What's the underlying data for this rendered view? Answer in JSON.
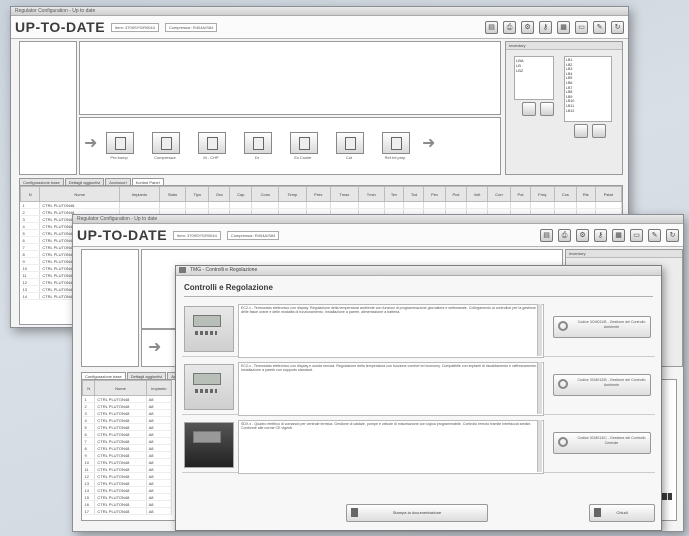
{
  "brand": {
    "logo_text": "UP-TO-DATE"
  },
  "back_window": {
    "titlebar_text": "Regulator Configuration - Up to date",
    "app_fields": [
      "Item: 3709SYS/R0044",
      "Compressor: R404A/S84"
    ],
    "tool_icons": [
      "document-icon",
      "printer-icon",
      "network-icon",
      "key-icon",
      "table-icon",
      "monitor-icon",
      "edit-icon",
      "refresh-icon"
    ],
    "flow_steps": [
      "Pre.bump",
      "Compressor",
      "M - CHP",
      "Dr",
      "Ev.Cooler",
      "Cut",
      "Ref.Inf.pmp"
    ],
    "side_panel": {
      "header": "Inventory",
      "left_list": [
        "LBA",
        "LB",
        "LB2"
      ],
      "right_list": [
        "LB1",
        "LB2",
        "LB3",
        "LB4",
        "LB5",
        "LB6",
        "LB7",
        "LB8",
        "LB9",
        "LB10",
        "LB11",
        "LB12"
      ]
    },
    "tabs": [
      "Configurazione base",
      "Dettagli aggiuntivi",
      "Accessori",
      "Kontrol Panel"
    ],
    "table": {
      "columns": [
        "N",
        "Nome",
        "Impianto",
        "Stato",
        "Tipo",
        "Ora",
        "Cap",
        "Cons",
        "Temp",
        "Pres",
        "Tmax",
        "Tmin",
        "Tev",
        "Tcd",
        "Pev",
        "Pcd",
        "Volt",
        "Corr",
        "Pot",
        "Freq",
        "Cos",
        "Ris",
        "Pstat"
      ],
      "rows": [
        [
          "1",
          "CTRL PLUTON48"
        ],
        [
          "2",
          "CTRL PLUTON48"
        ],
        [
          "3",
          "CTRL PLUTON48"
        ],
        [
          "4",
          "CTRL PLUTON48"
        ],
        [
          "5",
          "CTRL PLUTON48"
        ],
        [
          "6",
          "CTRL PLUTON48"
        ],
        [
          "7",
          "CTRL PLUTON48"
        ],
        [
          "8",
          "CTRL PLUTON48"
        ],
        [
          "9",
          "CTRL PLUTON48"
        ],
        [
          "10",
          "CTRL PLUTON48"
        ],
        [
          "11",
          "CTRL PLUTON48"
        ],
        [
          "12",
          "CTRL PLUTON48"
        ],
        [
          "13",
          "CTRL PLUTON48"
        ],
        [
          "14",
          "CTRL PLUTON48"
        ]
      ]
    }
  },
  "front_window": {
    "titlebar_text": "Regulator Configuration - Up to date",
    "app_fields": [
      "Item: 3709SYS/R0044",
      "Compressor: R404A/S84"
    ],
    "tabs": [
      "Configurazione base",
      "Dettagli aggiuntivi",
      "Accessori"
    ],
    "table": {
      "columns": [
        "N",
        "Nome",
        "Impianto"
      ],
      "rows": [
        [
          "1",
          "CTRL PLUTON48",
          "A8"
        ],
        [
          "2",
          "CTRL PLUTON48",
          "A8"
        ],
        [
          "3",
          "CTRL PLUTON48",
          "A8"
        ],
        [
          "4",
          "CTRL PLUTON48",
          "A8"
        ],
        [
          "5",
          "CTRL PLUTON48",
          "A8"
        ],
        [
          "6",
          "CTRL PLUTON48",
          "A8"
        ],
        [
          "7",
          "CTRL PLUTON48",
          "A8"
        ],
        [
          "8",
          "CTRL PLUTON48",
          "A8"
        ],
        [
          "9",
          "CTRL PLUTON48",
          "A8"
        ],
        [
          "10",
          "CTRL PLUTON48",
          "A8"
        ],
        [
          "11",
          "CTRL PLUTON48",
          "A8"
        ],
        [
          "12",
          "CTRL PLUTON48",
          "A8"
        ],
        [
          "13",
          "CTRL PLUTON48",
          "A8"
        ],
        [
          "14",
          "CTRL PLUTON48",
          "A8"
        ],
        [
          "15",
          "CTRL PLUTON48",
          "A8"
        ],
        [
          "16",
          "CTRL PLUTON48",
          "A8"
        ],
        [
          "17",
          "CTRL PLUTON48",
          "A8"
        ]
      ]
    }
  },
  "dialog": {
    "title": "TMG - Controlli e Regolazione",
    "heading": "Controlli e Regolazione",
    "items": [
      {
        "thumb": "thermostat-image",
        "description": "EC2.x - Termostato elettronico con display. Regolazione della temperatura ambiente con funzioni di programmazione giornaliera e settimanale. Collegamento ai controllori per la gestione delle fasce orarie e delle modalita di funzionamento. Installazione a parete, alimentazione a batteria.",
        "action": "Codice 3CM011/B - Gestione del Controllo Ambiente"
      },
      {
        "thumb": "thermostat-image",
        "description": "EC2.x - Termostato elettronico con display e sonda remota. Regolazione della temperatura con funzione comfort ed economy. Compatibile con impianti di riscaldamento e raffrescamento. Installazione a parete con supporto standard.",
        "action": "Codice 3CM012/B - Gestione del Controllo Ambiente"
      },
      {
        "thumb": "controller-image",
        "description": "SDX.x - Quadro elettrico di comando per centrale termica. Gestione di caldaie, pompe e valvole di miscelazione con logica programmabile. Controllo remoto tramite interfaccia seriale. Conforme alle norme CE vigenti.",
        "action": "Codice 3CM013/C - Gestione del Controllo Centrale"
      }
    ],
    "buttons": {
      "primary": "Stampa la documentazione",
      "secondary": "Chiudi"
    }
  }
}
